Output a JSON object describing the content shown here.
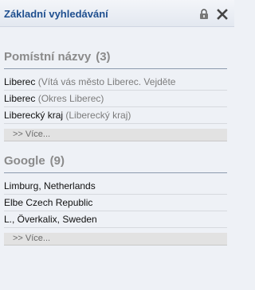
{
  "header": {
    "title": "Základní vyhledávání",
    "icons": [
      "lock-icon",
      "close-icon"
    ]
  },
  "sections": [
    {
      "title": "Pomístní názvy",
      "count": "(3)",
      "items": [
        {
          "name": "Liberec",
          "detail": "(Vítá vás město Liberec. Vejděte"
        },
        {
          "name": "Liberec",
          "detail": "(Okres Liberec)"
        },
        {
          "name": "Liberecký kraj",
          "detail": "(Liberecký kraj)"
        }
      ],
      "more_label": ">> Více..."
    },
    {
      "title": "Google",
      "count": "(9)",
      "items": [
        {
          "name": "Limburg, Netherlands",
          "detail": ""
        },
        {
          "name": "Elbe Czech Republic",
          "detail": ""
        },
        {
          "name": "L., Överkalix, Sweden",
          "detail": ""
        }
      ],
      "more_label": ">> Více..."
    }
  ]
}
